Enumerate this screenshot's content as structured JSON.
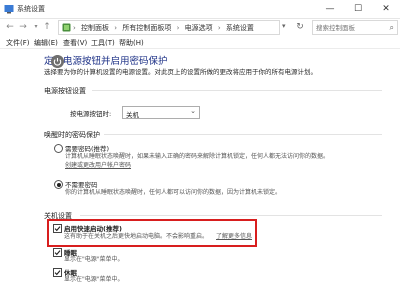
{
  "window": {
    "title": "系统设置",
    "min_glyph": "—",
    "max_glyph": "☐",
    "close_glyph": "✕"
  },
  "addressbar": {
    "breadcrumbs": [
      "控制面板",
      "所有控制面板项",
      "电源选项",
      "系统设置"
    ],
    "search_placeholder": "搜索控制面板"
  },
  "menu": [
    "文件(F)",
    "编辑(E)",
    "查看(V)",
    "工具(T)",
    "帮助(H)"
  ],
  "page": {
    "title": "定义电源按钮并启用密码保护",
    "desc_prefix": "选择要为你的计算机设置的电源设置。对此页上的设置所做的更改将应用于你的所有电源计划。"
  },
  "power_button": {
    "section": "电源按钮设置",
    "label": "按电源按钮时:",
    "value": "关机"
  },
  "wake_password": {
    "section": "唤醒时的密码保护",
    "options": [
      {
        "title": "需要密码(推荐)",
        "desc1": "计算机从睡眠状态唤醒时，如果未输入正确的密码来解除计算机锁定，任何人都无法访问你的数据。",
        "link": "创建或更改用户帐户密码",
        "selected": false
      },
      {
        "title": "不需要密码",
        "desc1": "你的计算机从睡眠状态唤醒时，任何人都可以访问你的数据，因为计算机未锁定。",
        "selected": true
      }
    ]
  },
  "shutdown": {
    "section": "关机设置",
    "fast_startup": {
      "title": "启用快速启动(推荐)",
      "desc": "这有助于在关机之后更快地启动电脑。不会影响重启。",
      "link": "了解更多信息",
      "checked": true
    },
    "sleep": {
      "title": "睡眠",
      "desc": "显示在\"电源\"菜单中。",
      "checked": true
    },
    "hibernate": {
      "title": "休眠",
      "desc": "显示在\"电源\"菜单中。",
      "checked": true
    }
  }
}
